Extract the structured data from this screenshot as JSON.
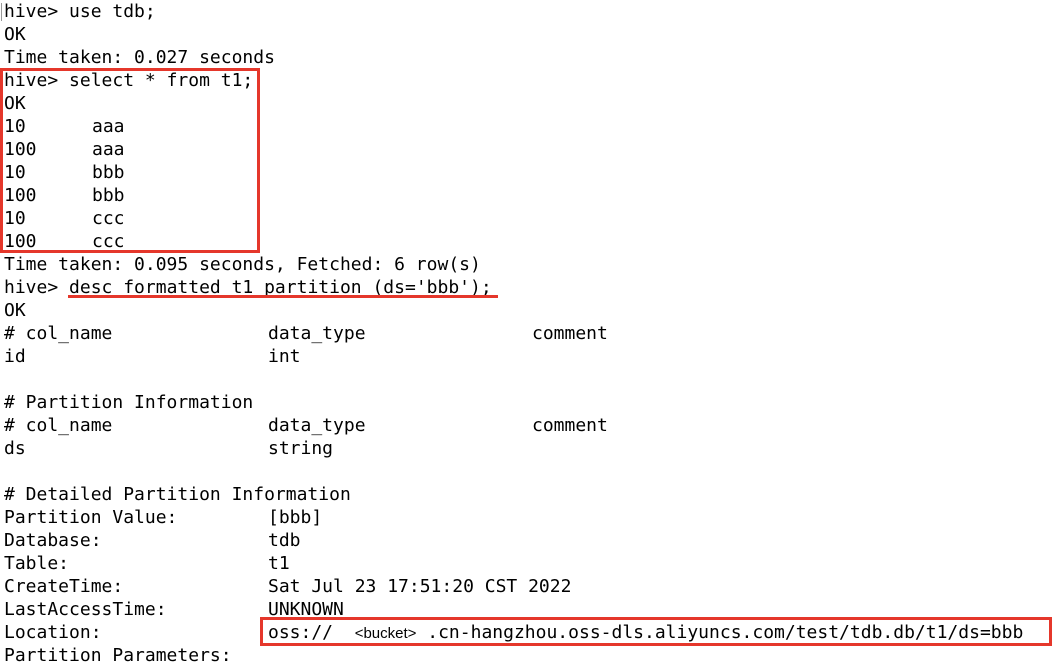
{
  "terminal": {
    "prompt": "hive> ",
    "lines": {
      "use_cmd": "use tdb;",
      "ok1": "OK",
      "time1": "Time taken: 0.027 seconds",
      "select_cmd": "select * from t1;",
      "ok2": "OK",
      "rows": [
        [
          "10",
          "aaa"
        ],
        [
          "100",
          "aaa"
        ],
        [
          "10",
          "bbb"
        ],
        [
          "100",
          "bbb"
        ],
        [
          "10",
          "ccc"
        ],
        [
          "100",
          "ccc"
        ]
      ],
      "time2": "Time taken: 0.095 seconds, Fetched: 6 row(s)",
      "desc_cmd": "desc formatted t1 partition (ds='bbb');",
      "ok3": "OK",
      "col_header": [
        "# col_name",
        "data_type",
        "comment"
      ],
      "col_row": [
        "id",
        "int"
      ],
      "partition_info_title": "# Partition Information",
      "part_header": [
        "# col_name",
        "data_type",
        "comment"
      ],
      "part_row": [
        "ds",
        "string"
      ],
      "detailed_title": "# Detailed Partition Information",
      "details": [
        [
          "Partition Value:",
          "[bbb]"
        ],
        [
          "Database:",
          "tdb"
        ],
        [
          "Table:",
          "t1"
        ],
        [
          "CreateTime:",
          "Sat Jul 23 17:51:20 CST 2022"
        ],
        [
          "LastAccessTime:",
          "UNKNOWN"
        ]
      ],
      "location_label": "Location:",
      "location_prefix": "oss://  ",
      "location_bucket": "<bucket>",
      "location_suffix": " .cn-hangzhou.oss-dls.aliyuncs.com/test/tdb.db/t1/ds=bbb",
      "partial_next": "Partition Parameters:"
    }
  },
  "colors": {
    "highlight": "#e5372b",
    "text": "#000000",
    "background": "#ffffff"
  }
}
